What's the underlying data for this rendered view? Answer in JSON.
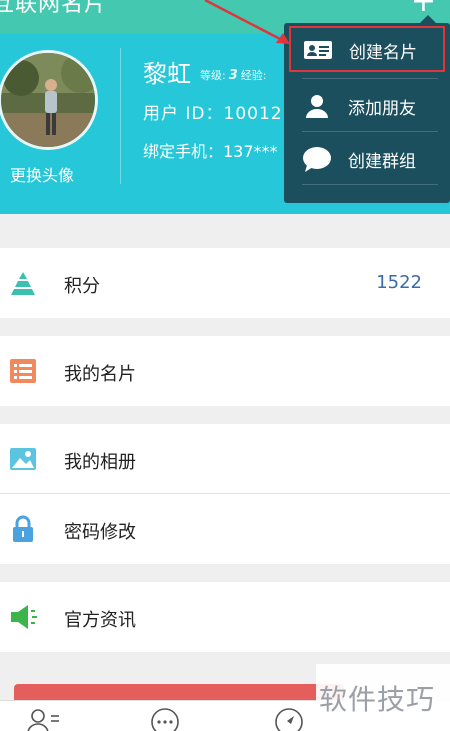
{
  "header": {
    "title": "互联网名片",
    "plus": "+"
  },
  "profile": {
    "name": "黎虹",
    "level_label": "等级:",
    "level_value": "3",
    "exp_label": "经验:",
    "user_id": "用户 ID：10012",
    "phone": "绑定手机：137***",
    "change_avatar": "更换头像"
  },
  "dropdown": {
    "items": [
      {
        "label": "创建名片",
        "icon": "business-card-icon",
        "highlighted": true
      },
      {
        "label": "添加朋友",
        "icon": "add-user-icon"
      },
      {
        "label": "创建群组",
        "icon": "chat-bubble-icon"
      }
    ]
  },
  "list": {
    "points": {
      "label": "积分",
      "value": "1522"
    },
    "my_card": {
      "label": "我的名片"
    },
    "my_album": {
      "label": "我的相册"
    },
    "change_password": {
      "label": "密码修改"
    },
    "news": {
      "label": "官方资讯"
    }
  },
  "watermark": {
    "text": "软件技巧"
  },
  "colors": {
    "topbar": "#45c8b0",
    "profile_bg": "#25c7d8",
    "dropdown_bg": "#1b4f5e",
    "highlight_border": "#e0353b",
    "points_value": "#3a6aa8",
    "logout_button": "#e45e5b"
  }
}
